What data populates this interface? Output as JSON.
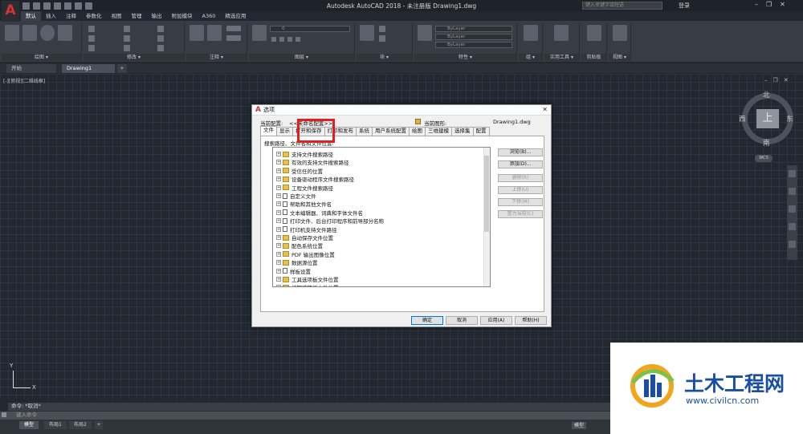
{
  "titlebar": {
    "title": "Autodesk AutoCAD 2018 - 未注册版    Drawing1.dwg",
    "search_placeholder": "键入关键字或短语",
    "login": "登录",
    "app_logo": "A"
  },
  "ribbon": {
    "tabs": [
      "默认",
      "插入",
      "注释",
      "参数化",
      "视图",
      "管理",
      "输出",
      "附加模块",
      "A360",
      "精选应用"
    ],
    "panels": [
      "绘图 ▾",
      "修改 ▾",
      "注释 ▾",
      "图层 ▾",
      "块 ▾",
      "特性 ▾",
      "组 ▾",
      "实用工具 ▾",
      "剪贴板",
      "视图 ▾"
    ],
    "bylayer": "ByLayer",
    "layer_zero": "0"
  },
  "filetabs": {
    "start": "开始",
    "drawing": "Drawing1",
    "add": "+"
  },
  "canvas": {
    "viewport_label": "[-][俯视][二维线框]",
    "controls": [
      "–",
      "❐",
      "✕"
    ],
    "viewcube": {
      "north": "北",
      "south": "南",
      "east": "东",
      "west": "西",
      "face": "上",
      "wcs": "WCS"
    },
    "ucs": {
      "x": "X",
      "y": "Y"
    }
  },
  "command": {
    "history": "命令: *取消*",
    "placeholder": "键入命令"
  },
  "layout_tabs": [
    "模型",
    "布局1",
    "布局2",
    "+"
  ],
  "status": {
    "model": "模型"
  },
  "dialog": {
    "title": "选项",
    "current_profile_label": "当前配置:",
    "current_profile_value": "<<未命名配置>>",
    "current_drawing_label": "当前图形:",
    "current_drawing_value": "Drawing1.dwg",
    "tabs": [
      "文件",
      "显示",
      "打开和保存",
      "打印和发布",
      "系统",
      "用户系统配置",
      "绘图",
      "三维建模",
      "选择集",
      "配置"
    ],
    "search_label": "搜索路径、文件名和文件位置:",
    "tree_items": [
      "支持文件搜索路径",
      "有效的支持文件搜索路径",
      "受信任的位置",
      "设备驱动程序文件搜索路径",
      "工程文件搜索路径",
      "自定义文件",
      "帮助和其他文件名",
      "文本编辑器、词典和字体文件名",
      "打印文件、后台打印程序和前导部分名称",
      "打印机支持文件路径",
      "自动保存文件位置",
      "配色系统位置",
      "PDF 输出图像位置",
      "数据源位置",
      "样板设置",
      "工具选项板文件位置",
      "编写选项板文件位置"
    ],
    "side_buttons": [
      "浏览(B)...",
      "添加(D)...",
      "删除(R)",
      "上移(U)",
      "下移(M)",
      "置为当前(C)"
    ],
    "buttons": {
      "ok": "确定",
      "cancel": "取消",
      "apply": "应用(A)",
      "help": "帮助(H)"
    }
  },
  "watermark": {
    "title": "土木工程网",
    "url": "www.civilcn.com"
  },
  "colors": {
    "accent_red": "#e02020",
    "autocad_red": "#d23333",
    "watermark_blue": "#1a4ea0"
  }
}
